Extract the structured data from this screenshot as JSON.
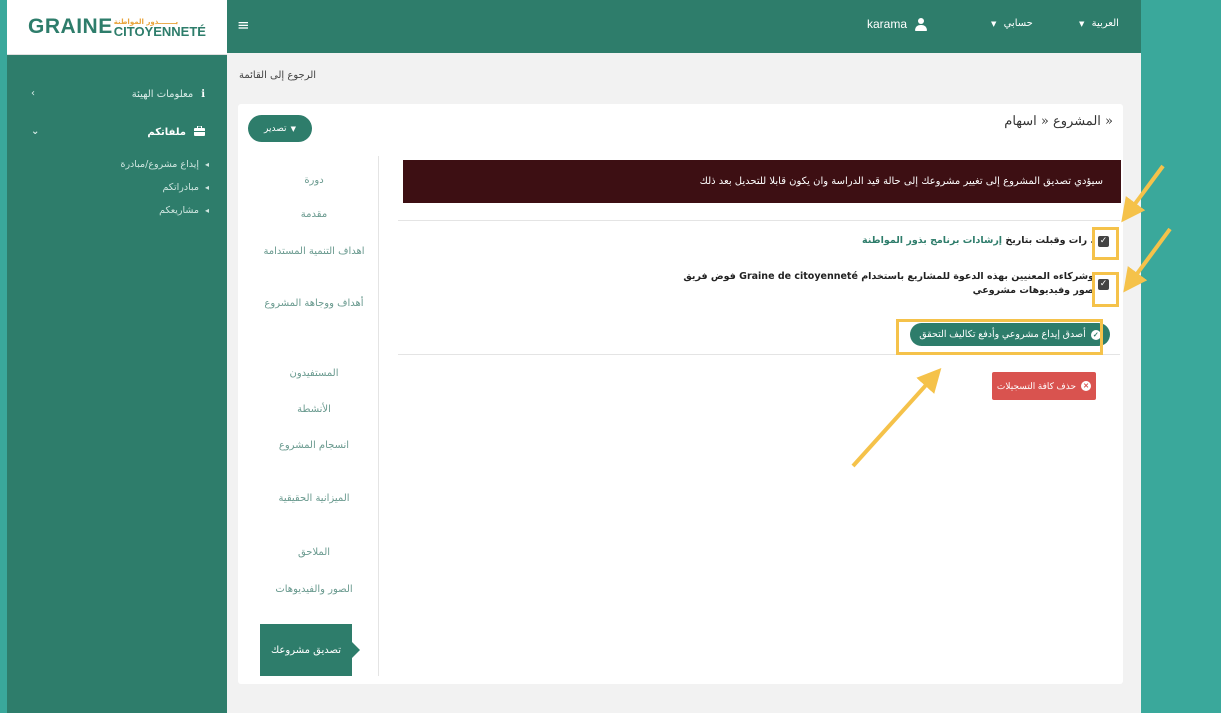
{
  "brand": {
    "main": "GRAINE",
    "top": "بـــــــذور المواطنة",
    "bottom": "CITOYENNETÉ"
  },
  "sidebar": {
    "items": [
      {
        "label": "معلومات الهيئة",
        "icon": "info-icon"
      },
      {
        "label": "ملفاتكم",
        "icon": "briefcase-icon"
      }
    ],
    "subitems": [
      {
        "label": "إيداع مشروع/مبادرة"
      },
      {
        "label": "مبادراتكم"
      },
      {
        "label": "مشاريعكم"
      }
    ]
  },
  "topbar": {
    "username": "karama",
    "account_label": "حسابي",
    "language_label": "العربية"
  },
  "back_link": "الرجوع إلى القائمة",
  "export_label": "تصدير",
  "project_title": "المشروع « اسهام »",
  "steps": [
    {
      "label": "دورة"
    },
    {
      "label": "مقدمة"
    },
    {
      "label": "اهداف التنمية المستدامة"
    },
    {
      "label": "أهداف ووجاهة المشروع"
    },
    {
      "label": "المستفيدون"
    },
    {
      "label": "الأنشطة"
    },
    {
      "label": "انسجام المشروع"
    },
    {
      "label": "الميزانية الحقيقية"
    },
    {
      "label": "الملاحق"
    },
    {
      "label": "الصور والفيديوهات"
    },
    {
      "label": "تصديق مشروعك"
    }
  ],
  "alert_text": "سيؤدي تصديق المشروع إلى تغيير مشروعك إلى حالة قيد الدراسة وان يكون قابلا للتحديل بعد ذلك",
  "checks": [
    {
      "prefix": "رات وقبلت بتاريخ ",
      "link": "إرشادات برنامج بذور المواطنة",
      "suffix": " ."
    },
    {
      "line1": "فوض فريق Graine de citoyenneté وشركاءه المعنيين بهذه الدعوة للمشاريع باستخدام",
      "line2": "صور وفيديوهات مشروعي"
    }
  ],
  "confirm_label": "أصدق إيداع مشروعي وأدفع تكاليف التحقق",
  "delete_label": "حذف كافة التسجيلات",
  "colors": {
    "primary": "#2e7d6b",
    "alert_bg": "#3d0f13",
    "danger": "#d9534f",
    "highlight": "#f5c24a",
    "background": "#3aa89b"
  }
}
